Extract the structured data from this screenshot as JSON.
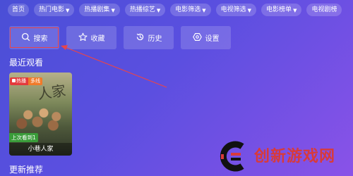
{
  "filters": [
    {
      "label": "首页",
      "dropdown": false
    },
    {
      "label": "热门电影",
      "dropdown": true
    },
    {
      "label": "热播剧集",
      "dropdown": true
    },
    {
      "label": "热播综艺",
      "dropdown": true
    },
    {
      "label": "电影筛选",
      "dropdown": true
    },
    {
      "label": "电视筛选",
      "dropdown": true
    },
    {
      "label": "电影榜单",
      "dropdown": true
    },
    {
      "label": "电视剧榜",
      "dropdown": false
    }
  ],
  "actions": {
    "search": "搜索",
    "favorites": "收藏",
    "history": "历史",
    "settings": "设置"
  },
  "recent": {
    "title": "最近观看",
    "card": {
      "badge_hot": "热播",
      "badge_multi": "多线",
      "progress": "上次看到1",
      "name": "小巷人家"
    }
  },
  "recommend": {
    "title": "更新推荐"
  },
  "watermark": {
    "text": "创新游戏网"
  },
  "colors": {
    "highlight": "#e8454a",
    "watermark": "#d83a3a"
  }
}
